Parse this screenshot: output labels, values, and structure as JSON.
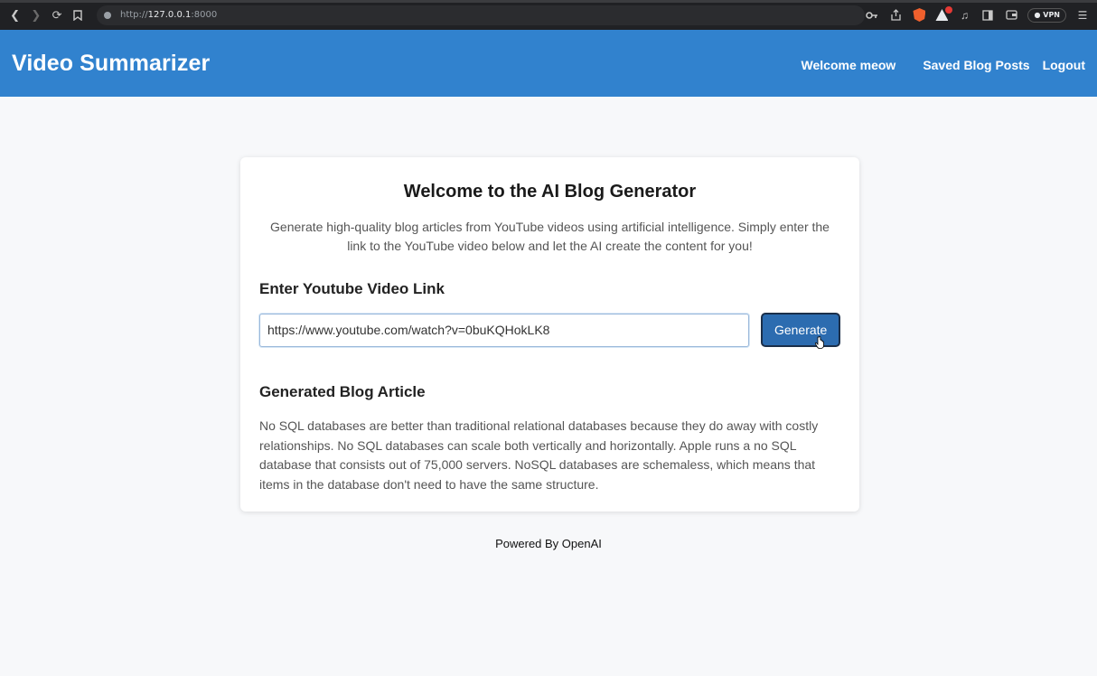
{
  "browser": {
    "url_scheme": "http://",
    "url_host": "127.0.0.1",
    "url_port": ":8000",
    "vpn_label": "VPN",
    "icons": [
      "back-icon",
      "forward-icon",
      "reload-icon",
      "bookmark-icon",
      "key-icon",
      "share-icon",
      "brave-shield-icon",
      "brave-rewards-icon",
      "music-icon",
      "sidebar-icon",
      "wallet-icon",
      "menu-icon"
    ]
  },
  "navbar": {
    "brand": "Video Summarizer",
    "welcome": "Welcome meow",
    "saved": "Saved Blog Posts",
    "logout": "Logout",
    "background_color": "#3182ce"
  },
  "card": {
    "title": "Welcome to the AI Blog Generator",
    "description": "Generate high-quality blog articles from YouTube videos using artificial intelligence. Simply enter the link to the YouTube video below and let the AI create the content for you!",
    "link_label": "Enter Youtube Video Link",
    "link_value": "https://www.youtube.com/watch?v=0buKQHokLK8",
    "generate_label": "Generate",
    "article_label": "Generated Blog Article",
    "article_text": "No SQL databases are better than traditional relational databases because they do away with costly relationships. No SQL databases can scale both vertically and horizontally. Apple runs a no SQL database that consists out of 75,000 servers. NoSQL databases are schemaless, which means that items in the database don't need to have the same structure."
  },
  "footer": {
    "text": "Powered By OpenAI"
  }
}
